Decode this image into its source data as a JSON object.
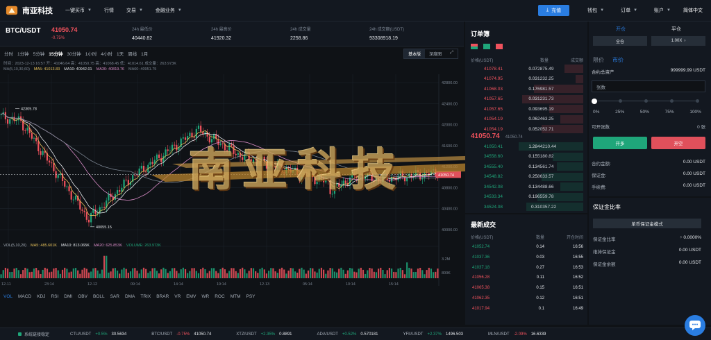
{
  "nav": {
    "brand": "南亚科技",
    "items": [
      "一键买币",
      "行情",
      "交易",
      "金融业务"
    ],
    "deposit": "充值",
    "right_items": [
      "钱包",
      "订单",
      "账户"
    ],
    "language": "简体中文"
  },
  "ticker": {
    "pair": "BTC/USDT",
    "price": "41050.74",
    "change": "-0.75%",
    "stats": [
      {
        "label": "24h 最低价",
        "value": "40440.82"
      },
      {
        "label": "24h 最高价",
        "value": "41920.32"
      },
      {
        "label": "24h 成交量",
        "value": "2258.86"
      },
      {
        "label": "24h 成交额(USDT)",
        "value": "93308918.19"
      }
    ]
  },
  "chart": {
    "intervals": [
      "分时",
      "1分钟",
      "5分钟",
      "15分钟",
      "30分钟",
      "1小时",
      "4小时",
      "1天",
      "周线",
      "1月"
    ],
    "active_interval": "15分钟",
    "views": [
      "基本版",
      "深度图"
    ],
    "ohlc": "时间：2023-12-13 16:57    开：41046.64    高：41050.75    高：41068.45    低：41014.61    成交量：263.973K",
    "ma_params": "MA(5,10,30,60)",
    "ma_values": [
      {
        "label": "MA5: 41013.83",
        "color": "#e6c15a"
      },
      {
        "label": "MA10: 40942.01",
        "color": "#e3e6ea"
      },
      {
        "label": "MA30: 40819.76",
        "color": "#d98cc7"
      },
      {
        "label": "MA60: 40951.75",
        "color": "#7b8592"
      }
    ],
    "high_marker": "42305.78",
    "low_marker": "40055.15",
    "current_marker": "41050.74",
    "y_ticks": [
      "42800.00",
      "42400.00",
      "42000.00",
      "41600.00",
      "41200.00",
      "40800.00",
      "40400.00",
      "40000.00"
    ],
    "x_ticks": [
      "12-11",
      "23:14",
      "12-12",
      "09:14",
      "14:14",
      "19:14",
      "12-13",
      "05:14",
      "10:14",
      "15:14"
    ],
    "vol_line": [
      {
        "label": "VOL(5,10,20)",
        "color": "#aab2bc"
      },
      {
        "label": "MA5: 485.601K",
        "color": "#e6c15a"
      },
      {
        "label": "MA10: 813.065K",
        "color": "#e3e6ea"
      },
      {
        "label": "MA20: 625.853K",
        "color": "#d98cc7"
      },
      {
        "label": "VOLUME: 263.973K",
        "color": "#1fa67a"
      }
    ],
    "vol_ticks": [
      "3.2M",
      "800K"
    ],
    "indicators": [
      "VOL",
      "MACD",
      "KDJ",
      "RSI",
      "DMI",
      "OBV",
      "BOLL",
      "SAR",
      "DMA",
      "TRIX",
      "BRAR",
      "VR",
      "EMV",
      "WR",
      "ROC",
      "MTM",
      "PSY"
    ]
  },
  "chart_data": {
    "type": "candlestick",
    "y_range": [
      40000,
      42800
    ],
    "x_ticks": [
      "12-11",
      "23:14",
      "12-12",
      "09:14",
      "14:14",
      "19:14",
      "12-13",
      "05:14",
      "10:14",
      "15:14"
    ],
    "high": 42305.78,
    "low": 40055.15,
    "last": 41050.74
  },
  "orderbook": {
    "title": "订单簿",
    "headers": [
      "价格(USDT)",
      "数量",
      "成交额"
    ],
    "asks": [
      {
        "price": "41078.41",
        "qty": "0.07",
        "amount": "2875.49",
        "depth": 0.25
      },
      {
        "price": "41074.95",
        "qty": "0.03",
        "amount": "1232.25",
        "depth": 0.1
      },
      {
        "price": "41068.03",
        "qty": "0.17",
        "amount": "6981.57",
        "depth": 0.65
      },
      {
        "price": "41057.65",
        "qty": "0.03",
        "amount": "1231.73",
        "depth": 0.8
      },
      {
        "price": "41057.65",
        "qty": "0.09",
        "amount": "3695.19",
        "depth": 0.45
      },
      {
        "price": "41054.19",
        "qty": "0.06",
        "amount": "2463.25",
        "depth": 0.3
      },
      {
        "price": "41054.19",
        "qty": "0.05",
        "amount": "2052.71",
        "depth": 0.55
      }
    ],
    "last_price": "41050.74",
    "last_sub": "41050.74",
    "bids": [
      {
        "price": "41050.41",
        "qty": "1.28",
        "amount": "44210.44",
        "depth": 0.85
      },
      {
        "price": "34558.60",
        "qty": "0.15",
        "amount": "5180.82",
        "depth": 0.4
      },
      {
        "price": "34555.40",
        "qty": "0.13",
        "amount": "4561.74",
        "depth": 0.35
      },
      {
        "price": "34548.82",
        "qty": "0.25",
        "amount": "8633.57",
        "depth": 0.55
      },
      {
        "price": "34542.08",
        "qty": "0.13",
        "amount": "4488.66",
        "depth": 0.3
      },
      {
        "price": "34533.34",
        "qty": "0.19",
        "amount": "6559.78",
        "depth": 0.6
      },
      {
        "price": "34524.08",
        "qty": "0.3",
        "amount": "10357.22",
        "depth": 0.75
      }
    ]
  },
  "trades": {
    "title": "最新成交",
    "headers": [
      "价格(USDT)",
      "数量",
      "开仓时间"
    ],
    "rows": [
      {
        "price": "41052.74",
        "qty": "0.14",
        "time": "16:56",
        "color": "#1fa67a"
      },
      {
        "price": "41037.36",
        "qty": "0.03",
        "time": "16:55",
        "color": "#1fa67a"
      },
      {
        "price": "41037.18",
        "qty": "0.27",
        "time": "16:53",
        "color": "#1fa67a"
      },
      {
        "price": "41056.28",
        "qty": "0.11",
        "time": "16:52",
        "color": "#f0525d"
      },
      {
        "price": "41065.38",
        "qty": "0.15",
        "time": "16:51",
        "color": "#f0525d"
      },
      {
        "price": "41062.35",
        "qty": "0.12",
        "time": "16:51",
        "color": "#f0525d"
      },
      {
        "price": "41017.94",
        "qty": "0.1",
        "time": "16:49",
        "color": "#f0525d"
      }
    ]
  },
  "form": {
    "tabs": [
      "开仓",
      "平仓"
    ],
    "margin_mode": "全仓",
    "leverage": "1.00X",
    "order_types": [
      "限价",
      "市价"
    ],
    "total_label": "合约总资产",
    "total_value": "999999.99 USDT",
    "qty_placeholder": "张数",
    "slider_labels": [
      "0%",
      "25%",
      "50%",
      "75%",
      "100%"
    ],
    "openable_label": "可开张数",
    "openable_value": "0 张",
    "buy_label": "开多",
    "sell_label": "开空",
    "kv": [
      {
        "label": "合约金额:",
        "value": "0.00 USDT"
      },
      {
        "label": "保证金:",
        "value": "0.00 USDT"
      },
      {
        "label": "手续费:",
        "value": "0.00 USDT"
      }
    ]
  },
  "margin": {
    "title": "保证金比率",
    "mode": "单币保证金模式",
    "kv": [
      {
        "label": "保证金比率",
        "value": "0.0000%"
      },
      {
        "label": "维持保证金",
        "value": "0.00 USDT"
      },
      {
        "label": "保证金余额",
        "value": "0.00 USDT"
      }
    ]
  },
  "bottom": {
    "connection": "系统链接稳定",
    "tickers": [
      {
        "pair": "CTU/USDT",
        "change": "+0.5%",
        "price": "30.5634",
        "color": "#1fa67a"
      },
      {
        "pair": "BTC/USDT",
        "change": "-0.75%",
        "price": "41050.74",
        "color": "#f0525d"
      },
      {
        "pair": "XTZ/USDT",
        "change": "+2.35%",
        "price": "0.8891",
        "color": "#1fa67a"
      },
      {
        "pair": "ADA/USDT",
        "change": "+0.52%",
        "price": "0.570181",
        "color": "#1fa67a"
      },
      {
        "pair": "YFII/USDT",
        "change": "+2.37%",
        "price": "1496.503",
        "color": "#1fa67a"
      },
      {
        "pair": "MLN/USDT",
        "change": "-2.09%",
        "price": "16.6339",
        "color": "#f0525d"
      }
    ]
  },
  "watermark": "南亚科技",
  "colors": {
    "up": "#1fa67a",
    "down": "#f0525d",
    "accent": "#2a7de1"
  }
}
